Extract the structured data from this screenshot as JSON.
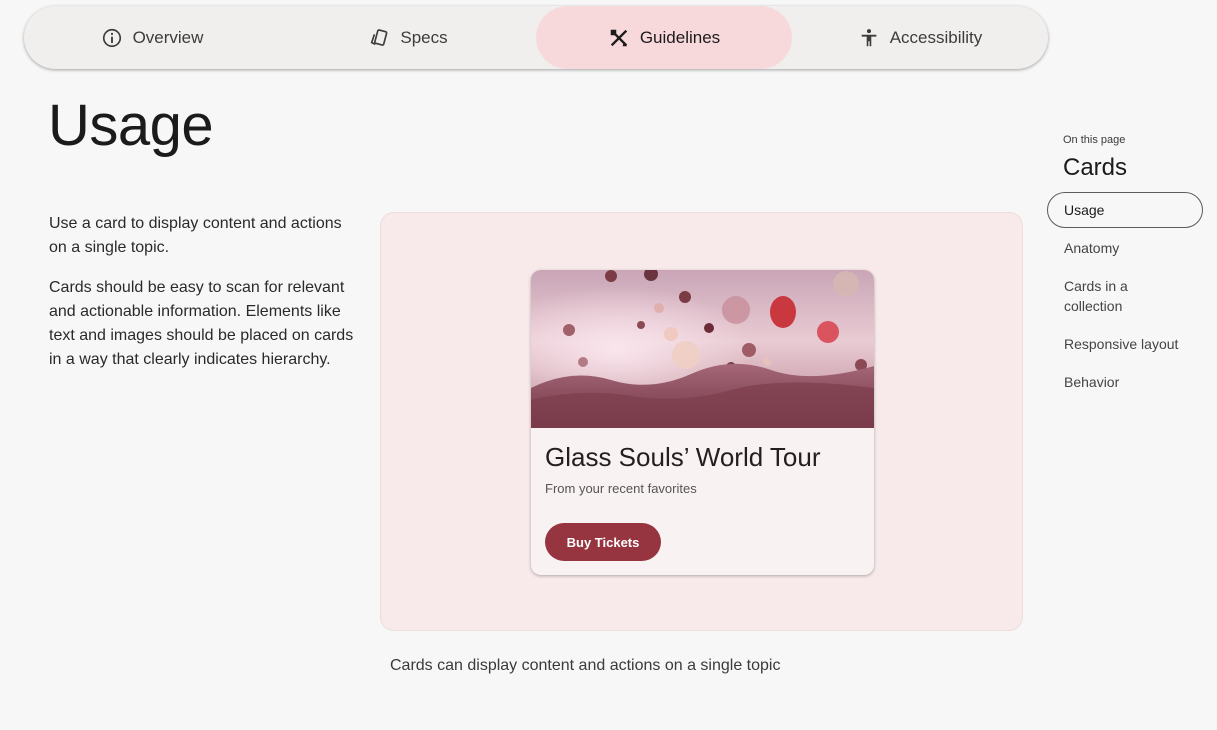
{
  "tabs": [
    {
      "label": "Overview",
      "icon": "info-icon",
      "active": false
    },
    {
      "label": "Specs",
      "icon": "specs-icon",
      "active": false
    },
    {
      "label": "Guidelines",
      "icon": "design-tools-icon",
      "active": true
    },
    {
      "label": "Accessibility",
      "icon": "accessibility-icon",
      "active": false
    }
  ],
  "main": {
    "title": "Usage",
    "paragraphs": [
      "Use a card to display content and actions on a single topic.",
      "Cards should be easy to scan for relevant and actionable information. Elements like text and images should be placed on cards in a way that clearly indicates hierarchy."
    ],
    "example_card": {
      "title": "Glass Souls’ World Tour",
      "subtitle": "From your recent favorites",
      "button_label": "Buy Tickets",
      "button_color": "#96353f"
    },
    "caption": "Cards can display content and actions on a single topic"
  },
  "toc": {
    "eyebrow": "On this page",
    "title": "Cards",
    "items": [
      {
        "label": "Usage",
        "active": true
      },
      {
        "label": "Anatomy",
        "active": false
      },
      {
        "label": "Cards in a collection",
        "active": false
      },
      {
        "label": "Responsive layout",
        "active": false
      },
      {
        "label": "Behavior",
        "active": false
      }
    ]
  },
  "colors": {
    "active_tab": "#f7d9dc",
    "demo_surface": "#f8eaea",
    "accent": "#96353f"
  }
}
